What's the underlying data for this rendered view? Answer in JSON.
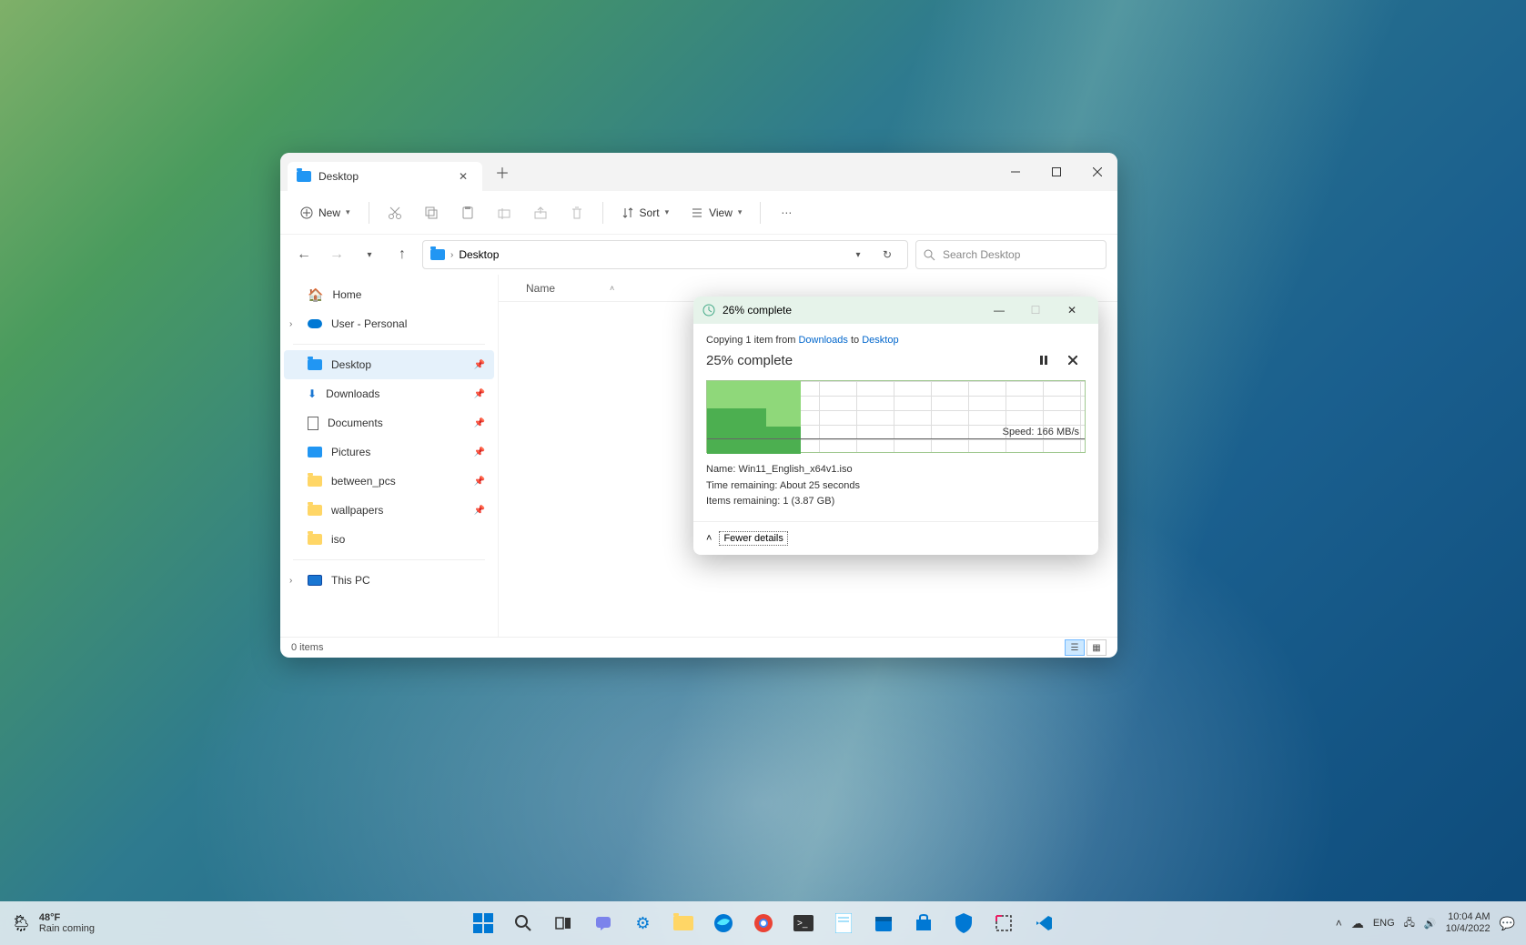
{
  "explorer": {
    "tab_title": "Desktop",
    "toolbar": {
      "new": "New",
      "sort": "Sort",
      "view": "View"
    },
    "address": {
      "current": "Desktop"
    },
    "search_placeholder": "Search Desktop",
    "sidebar": {
      "home": "Home",
      "user": "User - Personal",
      "pinned": [
        {
          "label": "Desktop",
          "icon": "folder-blue",
          "active": true
        },
        {
          "label": "Downloads",
          "icon": "download"
        },
        {
          "label": "Documents",
          "icon": "doc"
        },
        {
          "label": "Pictures",
          "icon": "pic"
        },
        {
          "label": "between_pcs",
          "icon": "folder"
        },
        {
          "label": "wallpapers",
          "icon": "folder"
        },
        {
          "label": "iso",
          "icon": "folder"
        }
      ],
      "this_pc": "This PC"
    },
    "columns": {
      "name": "Name"
    },
    "status": "0 items"
  },
  "copy_dialog": {
    "title": "26% complete",
    "copying_prefix": "Copying 1 item from ",
    "from": "Downloads",
    "to_word": " to ",
    "to": "Desktop",
    "percent": "25% complete",
    "speed": "Speed: 166 MB/s",
    "name_label": "Name:  ",
    "name_value": "Win11_English_x64v1.iso",
    "time_label": "Time remaining:  ",
    "time_value": "About 25 seconds",
    "items_label": "Items remaining:  ",
    "items_value": "1 (3.87 GB)",
    "fewer": "Fewer details"
  },
  "taskbar": {
    "temp": "48°F",
    "weather": "Rain coming",
    "lang": "ENG",
    "time": "10:04 AM",
    "date": "10/4/2022"
  }
}
